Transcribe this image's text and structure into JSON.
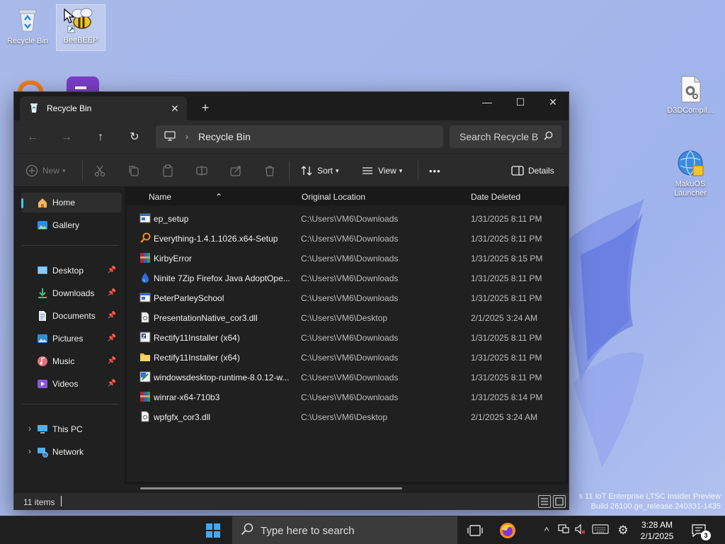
{
  "desktop": {
    "icons": [
      {
        "label": "Recycle Bin"
      },
      {
        "label": "BeeBEEP"
      },
      {
        "label": "D3DCompil..."
      },
      {
        "label": "MakuOS Launcher"
      }
    ],
    "watermark": {
      "line1": "s 11 IoT Enterprise LTSC Insider Preview",
      "line2": "Build 26100.ge_release.240331-1435"
    }
  },
  "window": {
    "tab_title": "Recycle Bin",
    "address": {
      "crumb": "Recycle Bin"
    },
    "search_placeholder": "Search Recycle B",
    "commands": {
      "new": "New",
      "sort": "Sort",
      "view": "View",
      "more": "•••",
      "details": "Details"
    },
    "sidebar": {
      "items": [
        {
          "label": "Home"
        },
        {
          "label": "Gallery"
        },
        {
          "label": "Desktop"
        },
        {
          "label": "Downloads"
        },
        {
          "label": "Documents"
        },
        {
          "label": "Pictures"
        },
        {
          "label": "Music"
        },
        {
          "label": "Videos"
        },
        {
          "label": "This PC"
        },
        {
          "label": "Network"
        }
      ]
    },
    "columns": {
      "name": "Name",
      "location": "Original Location",
      "date": "Date Deleted"
    },
    "files": [
      {
        "name": "ep_setup",
        "location": "C:\\Users\\VM6\\Downloads",
        "date": "1/31/2025 8:11 PM",
        "icon": "app-window-icon"
      },
      {
        "name": "Everything-1.4.1.1026.x64-Setup",
        "location": "C:\\Users\\VM6\\Downloads",
        "date": "1/31/2025 8:11 PM",
        "icon": "magnifier-icon"
      },
      {
        "name": "KirbyError",
        "location": "C:\\Users\\VM6\\Downloads",
        "date": "1/31/2025 8:15 PM",
        "icon": "archive-icon"
      },
      {
        "name": "Ninite 7Zip Firefox Java AdoptOpe...",
        "location": "C:\\Users\\VM6\\Downloads",
        "date": "1/31/2025 8:11 PM",
        "icon": "ninite-icon"
      },
      {
        "name": "PeterParleySchool",
        "location": "C:\\Users\\VM6\\Downloads",
        "date": "1/31/2025 8:11 PM",
        "icon": "app-window-icon"
      },
      {
        "name": "PresentationNative_cor3.dll",
        "location": "C:\\Users\\VM6\\Desktop",
        "date": "2/1/2025 3:24 AM",
        "icon": "dll-file-icon"
      },
      {
        "name": "Rectify11Installer (x64)",
        "location": "C:\\Users\\VM6\\Downloads",
        "date": "1/31/2025 8:11 PM",
        "icon": "installer-icon"
      },
      {
        "name": "Rectify11Installer (x64)",
        "location": "C:\\Users\\VM6\\Downloads",
        "date": "1/31/2025 8:11 PM",
        "icon": "folder-icon"
      },
      {
        "name": "windowsdesktop-runtime-8.0.12-w...",
        "location": "C:\\Users\\VM6\\Downloads",
        "date": "1/31/2025 8:11 PM",
        "icon": "setup-icon"
      },
      {
        "name": "winrar-x64-710b3",
        "location": "C:\\Users\\VM6\\Downloads",
        "date": "1/31/2025 8:14 PM",
        "icon": "archive-icon"
      },
      {
        "name": "wpfgfx_cor3.dll",
        "location": "C:\\Users\\VM6\\Desktop",
        "date": "2/1/2025 3:24 AM",
        "icon": "dll-file-icon"
      }
    ],
    "status": {
      "count": "11 items"
    }
  },
  "taskbar": {
    "search_placeholder": "Type here to search",
    "time": "3:28 AM",
    "date": "2/1/2025",
    "notifications": "3"
  },
  "colors": {
    "accent": "#4cc2ff",
    "window_bg": "#202020",
    "taskbar_bg": "#1f1f1f",
    "desktop_bg": "#a4b6ea"
  }
}
